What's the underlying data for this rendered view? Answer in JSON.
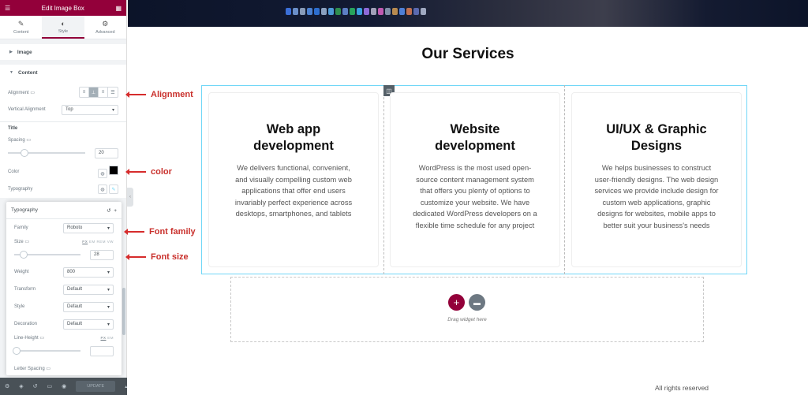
{
  "panel": {
    "title": "Edit Image Box",
    "tabs": [
      {
        "label": "Content",
        "icon": "pencil-icon"
      },
      {
        "label": "Style",
        "icon": "half-circle-icon"
      },
      {
        "label": "Advanced",
        "icon": "gear-icon"
      }
    ],
    "active_tab": "Style",
    "sections": {
      "image": "Image",
      "content": "Content"
    },
    "alignment_label": "Alignment",
    "vertical_alignment_label": "Vertical Alignment",
    "vertical_alignment_value": "Top",
    "title_heading": "Title",
    "spacing_label": "Spacing",
    "spacing_value": "20",
    "color_label": "Color",
    "color_value": "#000000",
    "typography_label": "Typography"
  },
  "popover": {
    "title": "Typography",
    "family_label": "Family",
    "family_value": "Roboto",
    "size_label": "Size",
    "units": [
      "PX",
      "EM",
      "REM",
      "VW"
    ],
    "size_value": "28",
    "weight_label": "Weight",
    "weight_value": "800",
    "transform_label": "Transform",
    "transform_value": "Default",
    "style_label": "Style",
    "style_value": "Default",
    "decoration_label": "Decoration",
    "decoration_value": "Default",
    "line_height_label": "Line-Height",
    "line_height_units": [
      "PX",
      "EM"
    ],
    "line_height_value": "",
    "letter_spacing_label": "Letter Spacing"
  },
  "footer": {
    "update_label": "UPDATE"
  },
  "annotations": {
    "alignment": "Alignment",
    "color": "color",
    "font_family": "Font family",
    "font_size": "Font size"
  },
  "page": {
    "section_title": "Our Services",
    "cards": [
      {
        "title": "Web app development",
        "text": "We delivers functional, convenient, and visually compelling custom web applications that offer end users invariably perfect experience across desktops, smartphones, and tablets"
      },
      {
        "title": "Website development",
        "text": "WordPress is the most used open-source content management system that offers you plenty of options to customize your website. We have dedicated WordPress developers on a flexible time schedule for any project"
      },
      {
        "title": "UI/UX & Graphic Designs",
        "text": "We helps businesses to construct user-friendly designs. The web design services we provide include design for custom web applications, graphic designs for websites, mobile apps to better suit your business's needs"
      }
    ],
    "drop_text": "Drag widget here",
    "footer_text": "All rights reserved"
  },
  "colors": {
    "brand": "#93003a",
    "accent_outline": "#71d7f7",
    "annotation": "#d62c2c",
    "folder_button": "#6d7882"
  }
}
